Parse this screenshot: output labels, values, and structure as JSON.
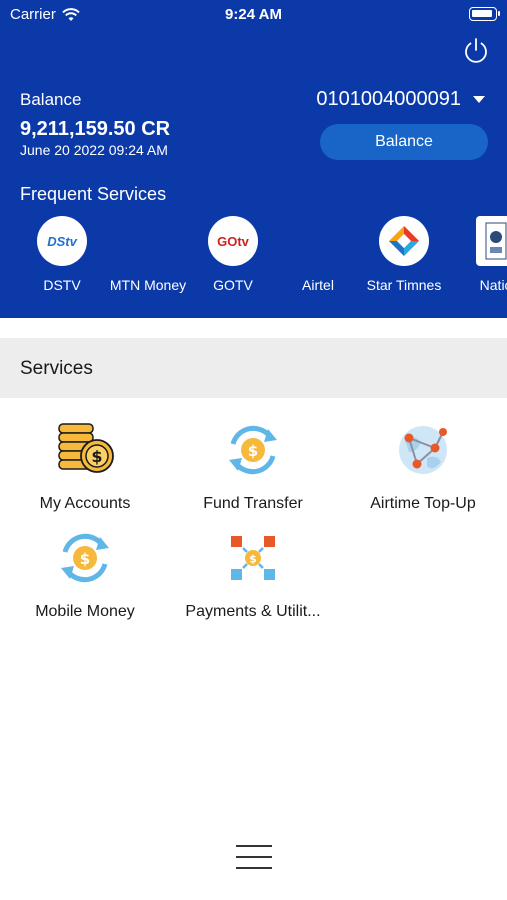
{
  "status_bar": {
    "carrier": "Carrier",
    "time": "9:24 AM"
  },
  "account": {
    "balance_label": "Balance",
    "amount": "9,211,159.50 CR",
    "date": "June 20 2022 09:24 AM",
    "number": "0101004000091",
    "balance_button": "Balance"
  },
  "frequent": {
    "title": "Frequent Services",
    "items": [
      {
        "name": "DSTV",
        "logo": "DStv"
      },
      {
        "name": "MTN Money",
        "logo": ""
      },
      {
        "name": "GOTV",
        "logo": "GOtv"
      },
      {
        "name": "Airtel",
        "logo": ""
      },
      {
        "name": "Star Timnes",
        "logo": ""
      },
      {
        "name": "Natio",
        "logo": ""
      }
    ]
  },
  "services": {
    "title": "Services",
    "items": [
      {
        "label": "My Accounts",
        "icon": "coins-icon"
      },
      {
        "label": "Fund Transfer",
        "icon": "transfer-icon"
      },
      {
        "label": "Airtime Top-Up",
        "icon": "globe-network-icon"
      },
      {
        "label": "Mobile Money",
        "icon": "transfer-icon"
      },
      {
        "label": "Payments & Utilit...",
        "icon": "payments-icon"
      }
    ]
  },
  "colors": {
    "header": "#0b3aa8",
    "balance_button": "#1864c7",
    "services_bar": "#ededed"
  }
}
